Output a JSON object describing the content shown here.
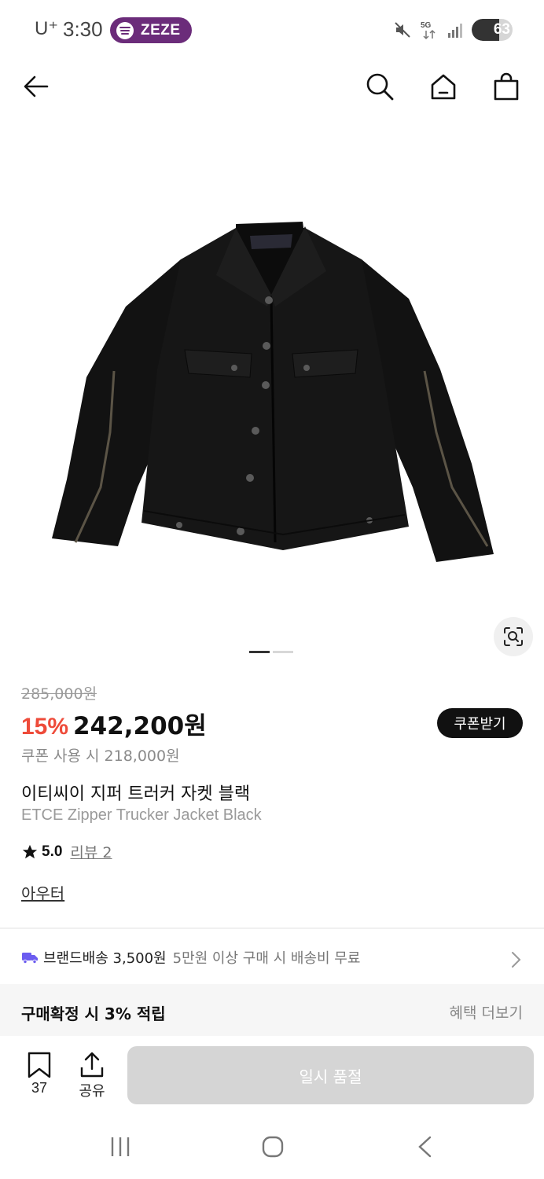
{
  "status_bar": {
    "carrier": "U⁺",
    "time": "3:30",
    "notification_pill": "ZEZE",
    "network": "5G",
    "battery": "63"
  },
  "nav": {
    "back_icon": "arrow-left-icon",
    "search_icon": "search-icon",
    "home_icon": "home-icon",
    "cart_icon": "shopping-bag-icon"
  },
  "gallery": {
    "image_alt": "black denim trucker jacket",
    "page_count": 2,
    "active_page": 1
  },
  "price": {
    "original": "285,000원",
    "discount": "15%",
    "sale": "242,200원",
    "coupon_button": "쿠폰받기",
    "coupon_price": "쿠폰 사용 시 218,000원"
  },
  "product": {
    "title_ko": "이티씨이 지퍼 트러커 자켓 블랙",
    "title_en": "ETCE Zipper Trucker Jacket Black",
    "rating": "5.0",
    "reviews": "리뷰 2",
    "category": "아우터"
  },
  "shipping": {
    "main": "브랜드배송 3,500원",
    "sub": "5만원 이상 구매 시 배송비 무료"
  },
  "benefit": {
    "text": "구매확정 시 3% 적립",
    "more": "혜택 더보기"
  },
  "bottom_bar": {
    "bookmark_count": "37",
    "share_label": "공유",
    "soldout_label": "일시 품절"
  },
  "colors": {
    "discount": "#ee4b3a",
    "spotify_pill": "#6b2c7a",
    "shipping_truck": "#6b5cf0"
  }
}
